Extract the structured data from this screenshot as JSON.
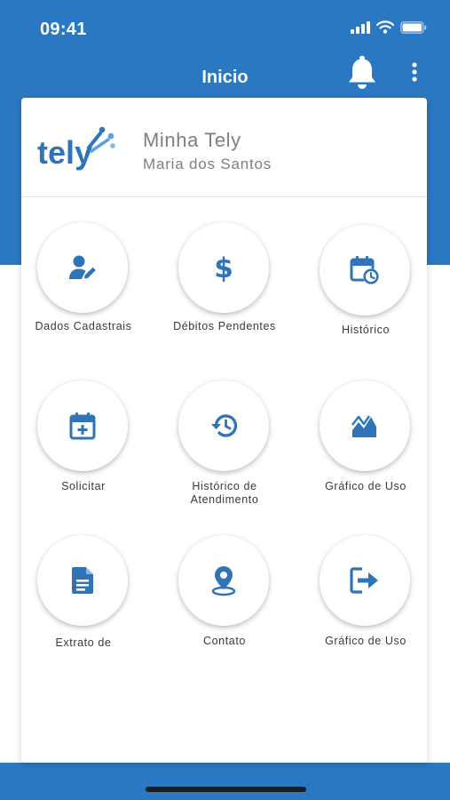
{
  "status_bar": {
    "time": "09:41"
  },
  "nav": {
    "title": "Inicio"
  },
  "profile": {
    "logo_text": "tely",
    "title": "Minha Tely",
    "name": "Maria dos Santos"
  },
  "colors": {
    "primary": "#2b78c2",
    "icon": "#2f73b8",
    "text_gray": "#7f7f7f"
  },
  "menu": [
    {
      "label": "Dados Cadastrais",
      "icon": "user-edit-icon"
    },
    {
      "label": "Débitos Pendentes",
      "icon": "dollar-icon"
    },
    {
      "label": "Histórico",
      "icon": "calendar-clock-icon"
    },
    {
      "label": "Solicitar",
      "icon": "calendar-plus-icon"
    },
    {
      "label": "Histórico de Atendimento",
      "icon": "history-icon"
    },
    {
      "label": "Gráfico de Uso",
      "icon": "chart-icon"
    },
    {
      "label": "Extrato de",
      "icon": "document-icon"
    },
    {
      "label": "Contato",
      "icon": "location-icon"
    },
    {
      "label": "Gráfico de Uso",
      "icon": "logout-icon"
    }
  ]
}
